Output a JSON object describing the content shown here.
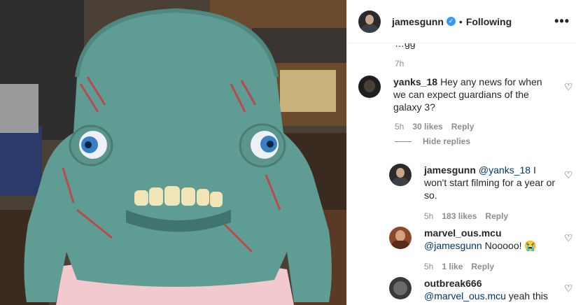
{
  "header": {
    "username": "jamesgunn",
    "separator": "•",
    "following_label": "Following",
    "more_label": "•••"
  },
  "comments_top": {
    "cut_text": "…gg",
    "time": "7h"
  },
  "comment_main": {
    "user": "yanks_18",
    "text": "Hey any news for when we can expect guardians of the galaxy 3?",
    "time": "5h",
    "likes": "30 likes",
    "reply_label": "Reply"
  },
  "hide_replies_label": "Hide replies",
  "replies": [
    {
      "user": "jamesgunn",
      "mention": "@yanks_18",
      "text": " I won't start filming for a year or so.",
      "time": "5h",
      "likes": "183 likes",
      "reply_label": "Reply"
    },
    {
      "user": "marvel_ous.mcu",
      "mention": "@jamesgunn",
      "text": " Nooooo! 😭",
      "time": "5h",
      "likes": "1 like",
      "reply_label": "Reply"
    },
    {
      "user": "outbreak666",
      "mention": "@marvel_ous.mcu",
      "text": " yeah this",
      "time": "",
      "likes": "",
      "reply_label": ""
    }
  ],
  "colors": {
    "mention": "#00376b",
    "verified": "#3897f0",
    "muted": "#8e8e8e"
  }
}
